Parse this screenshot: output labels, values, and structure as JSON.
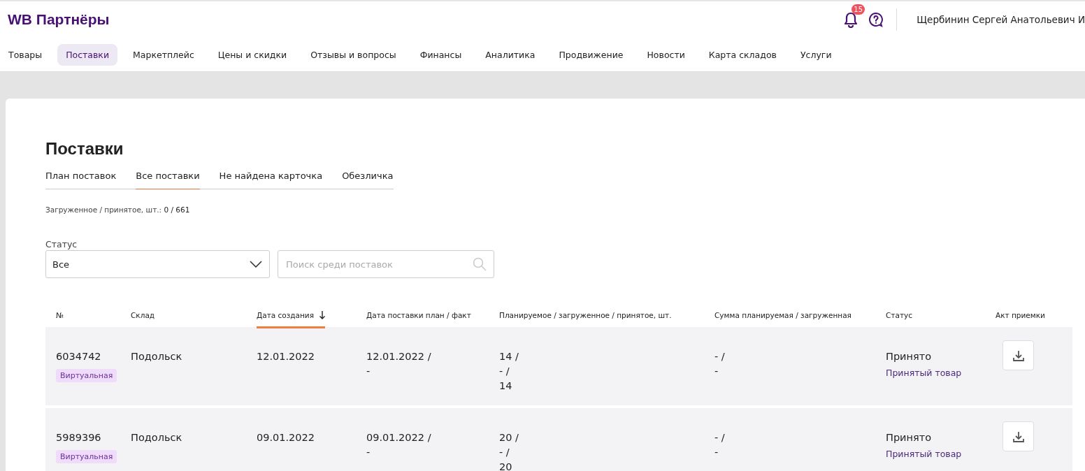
{
  "header": {
    "logo": "WB Партнёры",
    "notifications_count": "15",
    "user_name": "Щербинин Сергей Анатольевич И"
  },
  "nav": [
    {
      "label": "Товары",
      "selected": false
    },
    {
      "label": "Поставки",
      "selected": true
    },
    {
      "label": "Маркетплейс",
      "selected": false
    },
    {
      "label": "Цены и скидки",
      "selected": false
    },
    {
      "label": "Отзывы и вопросы",
      "selected": false
    },
    {
      "label": "Финансы",
      "selected": false
    },
    {
      "label": "Аналитика",
      "selected": false
    },
    {
      "label": "Продвижение",
      "selected": false
    },
    {
      "label": "Новости",
      "selected": false
    },
    {
      "label": "Карта складов",
      "selected": false
    },
    {
      "label": "Услуги",
      "selected": false
    }
  ],
  "page_title": "Поставки",
  "tabs": [
    {
      "label": "План поставок",
      "selected": false
    },
    {
      "label": "Все поставки",
      "selected": true
    },
    {
      "label": "Не найдена карточка",
      "selected": false
    },
    {
      "label": "Обезличка",
      "selected": false
    }
  ],
  "summary": {
    "label": "Загруженное / принятое, шт.:",
    "value": "0 / 661"
  },
  "filters": {
    "status_label": "Статус",
    "status_value": "Все",
    "search_placeholder": "Поиск среди поставок"
  },
  "table": {
    "columns": [
      {
        "label": "№",
        "sorted": false
      },
      {
        "label": "Склад",
        "sorted": false
      },
      {
        "label": "Дата создания",
        "sorted": true
      },
      {
        "label": "Дата поставки план / факт",
        "sorted": false
      },
      {
        "label": "Планируемое / загруженное / принятое, шт.",
        "sorted": false
      },
      {
        "label": "Сумма планируемая / загруженная",
        "sorted": false
      },
      {
        "label": "Статус",
        "sorted": false
      },
      {
        "label": "Акт приемки",
        "sorted": false
      }
    ],
    "rows": [
      {
        "number": "6034742",
        "tag": "Виртуальная",
        "warehouse": "Подольск",
        "created": "12.01.2022",
        "delivery": [
          "12.01.2022 /",
          "-"
        ],
        "quantities": [
          "14 /",
          "- /",
          "14"
        ],
        "sum": [
          "- /",
          "-"
        ],
        "status": "Принято",
        "status_link": "Принятый товар"
      },
      {
        "number": "5989396",
        "tag": "Виртуальная",
        "warehouse": "Подольск",
        "created": "09.01.2022",
        "delivery": [
          "09.01.2022 /",
          "-"
        ],
        "quantities": [
          "20 /",
          "- /",
          "20"
        ],
        "sum": [
          "- /",
          "-"
        ],
        "status": "Принято",
        "status_link": "Принятый товар"
      }
    ]
  }
}
